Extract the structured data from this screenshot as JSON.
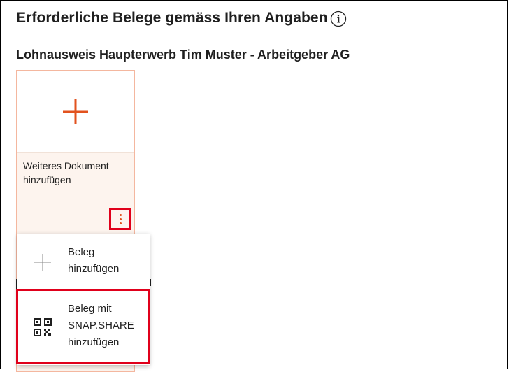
{
  "header": {
    "title": "Erforderliche Belege gemäss Ihren Angaben",
    "info_icon": "info-icon"
  },
  "section": {
    "title": "Lohnausweis Haupterwerb Tim Muster - Arbeitgeber AG"
  },
  "card": {
    "label": "Weiteres Dokument hinzufügen",
    "preview_icon": "plus-icon",
    "menu_icon": "more-vertical-icon",
    "accent_color": "#e2521e",
    "border_color": "#f4b79f",
    "background_color": "#fdf4ee"
  },
  "context_menu": {
    "items": [
      {
        "label_line1": "Beleg",
        "label_line2": "hinzufügen",
        "icon": "plus-icon"
      },
      {
        "label_line1": "Beleg mit",
        "label_line2": "SNAP.SHARE",
        "label_line3": "hinzufügen",
        "icon": "qr-code-icon"
      }
    ]
  },
  "highlight_color": "#e0001b"
}
